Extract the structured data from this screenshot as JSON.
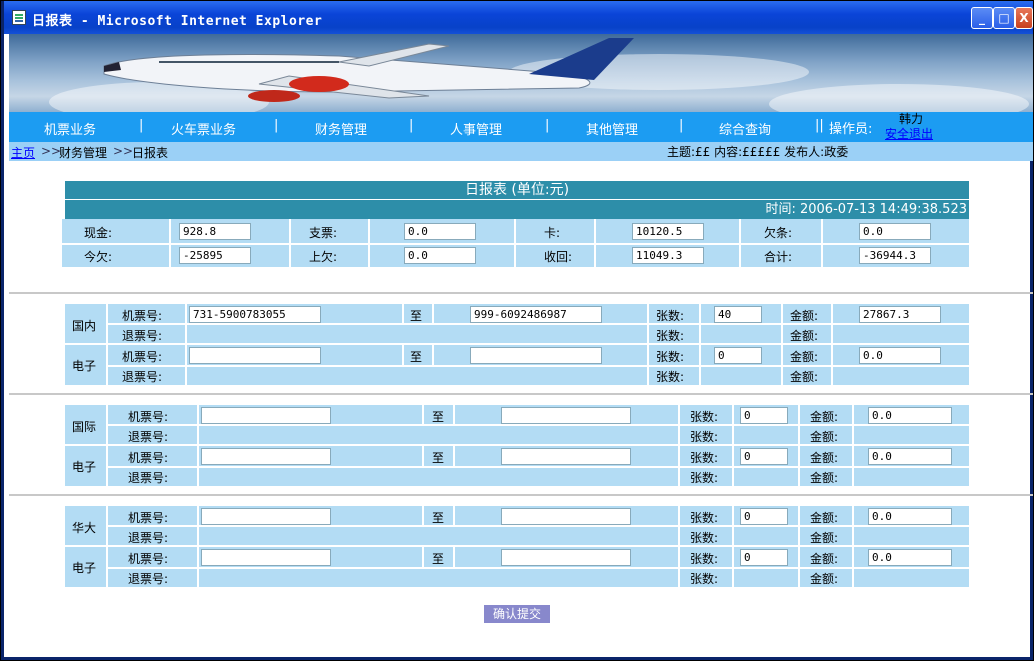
{
  "window": {
    "title": "日报表 - Microsoft Internet Explorer",
    "buttons": {
      "minimize": "_",
      "maximize": "□",
      "close": "X"
    }
  },
  "nav": {
    "items": [
      "机票业务",
      "火车票业务",
      "财务管理",
      "人事管理",
      "其他管理",
      "综合查询"
    ],
    "operator_label": "操作员:",
    "operator_name": "韩力",
    "logout": "安全退出"
  },
  "breadcrumb": {
    "home": "主页",
    "sep": ">>",
    "level1": "财务管理",
    "level2": "日报表"
  },
  "notice": "主题:££ 内容:£££££ 发布人:政委",
  "report": {
    "title": "日报表 (单位:元)",
    "time": "时间: 2006-07-13 14:49:38.523",
    "row1": [
      {
        "label": "现金:",
        "value": "928.8"
      },
      {
        "label": "支票:",
        "value": "0.0"
      },
      {
        "label": "卡:",
        "value": "10120.5"
      },
      {
        "label": "欠条:",
        "value": "0.0"
      }
    ],
    "row2": [
      {
        "label": "今欠:",
        "value": "-25895"
      },
      {
        "label": "上欠:",
        "value": "0.0"
      },
      {
        "label": "收回:",
        "value": "11049.3"
      },
      {
        "label": "合计:",
        "value": "-36944.3"
      }
    ]
  },
  "labels": {
    "ticket_no": "机票号:",
    "refund_no": "退票号:",
    "to": "至",
    "count": "张数:",
    "amount": "金额:",
    "electronic": "电子"
  },
  "sections": [
    {
      "name": "国内",
      "groups": [
        {
          "from": "731-5900783055",
          "to": "999-6092486987",
          "count": "40",
          "amount": "27867.3"
        },
        {
          "from": "",
          "to": "",
          "count": "0",
          "amount": "0.0"
        }
      ]
    },
    {
      "name": "国际",
      "groups": [
        {
          "from": "",
          "to": "",
          "count": "0",
          "amount": "0.0"
        },
        {
          "from": "",
          "to": "",
          "count": "0",
          "amount": "0.0"
        }
      ]
    },
    {
      "name": "华大",
      "groups": [
        {
          "from": "",
          "to": "",
          "count": "0",
          "amount": "0.0"
        },
        {
          "from": "",
          "to": "",
          "count": "0",
          "amount": "0.0"
        }
      ]
    }
  ],
  "submit": "确认提交"
}
